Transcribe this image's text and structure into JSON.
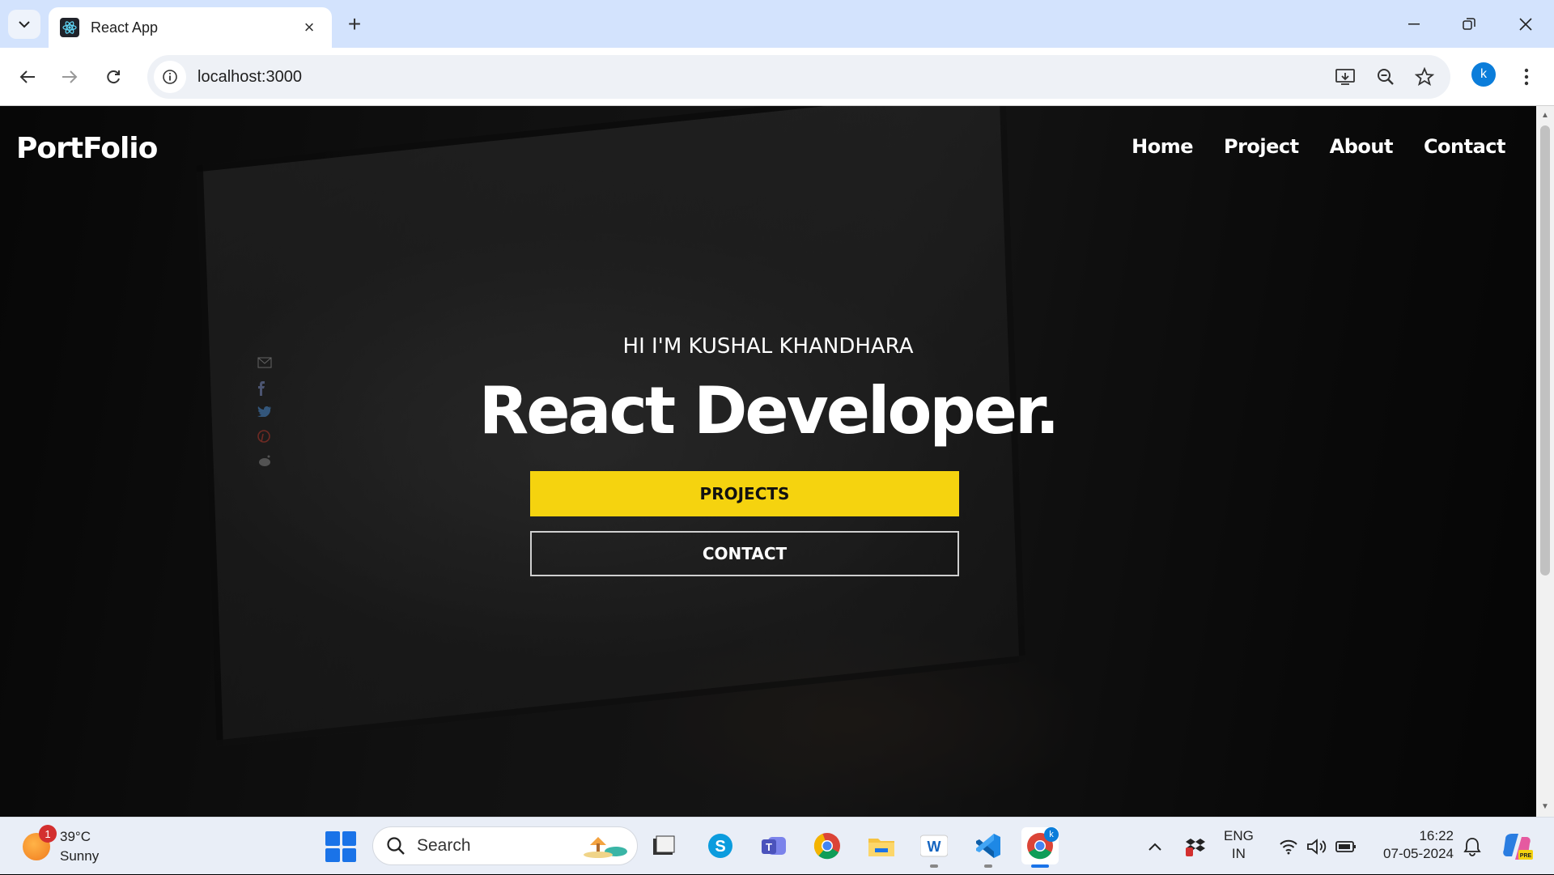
{
  "browser": {
    "tab_title": "React App",
    "url": "localhost:3000",
    "profile_initial": "k"
  },
  "site": {
    "logo": "PortFolio",
    "nav": [
      "Home",
      "Project",
      "About",
      "Contact"
    ],
    "intro": "HI I'M KUSHAL KHANDHARA",
    "headline": "React Developer.",
    "projects_button": "PROJECTS",
    "contact_button": "CONTACT"
  },
  "taskbar": {
    "weather_badge": "1",
    "temperature": "39°C",
    "condition": "Sunny",
    "search_placeholder": "Search",
    "lang_top": "ENG",
    "lang_bottom": "IN",
    "time": "16:22",
    "date": "07-05-2024",
    "chrome_badge": "k"
  },
  "colors": {
    "accent_yellow": "#f5d30f",
    "tabstrip": "#d3e3fd",
    "taskbar": "#e9eef7"
  }
}
